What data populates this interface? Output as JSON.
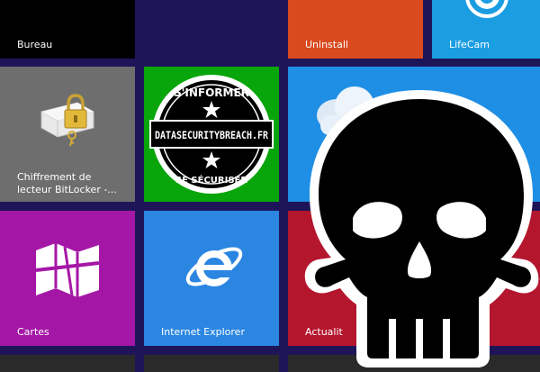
{
  "tiles": {
    "bureau": {
      "label": "Bureau"
    },
    "uninstall": {
      "label": "Uninstall"
    },
    "lifecam": {
      "label": "LifeCam"
    },
    "bitlocker": {
      "label": "Chiffrement de lecteur BitLocker -..."
    },
    "databreach": {
      "top_text": "S'INFORMER",
      "main_text": "DATASECURITYBREACH.FR",
      "bottom_text": "SE SÉCURISER"
    },
    "cartes": {
      "label": "Cartes"
    },
    "internet_explorer": {
      "label": "Internet Explorer"
    },
    "actualites": {
      "label": "Actualit"
    }
  },
  "overlay": {
    "icon": "skull-icon"
  },
  "colors": {
    "background": "#1d1558",
    "bureau": "#000000",
    "uninstall": "#d94a1f",
    "lifecam": "#1b9de2",
    "bitlocker": "#6e6e6e",
    "databreach": "#08a50b",
    "weather": "#1f8fe5",
    "cartes": "#a417a6",
    "internet_explorer": "#2b86e2",
    "actualites": "#b4162e"
  }
}
